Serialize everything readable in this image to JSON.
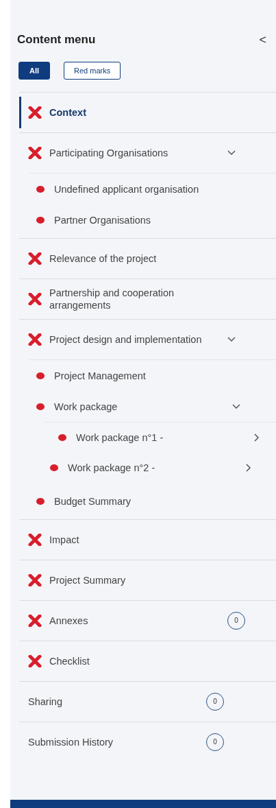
{
  "header": {
    "title": "Content menu",
    "collapse_icon": "<"
  },
  "filters": [
    {
      "label": "All",
      "selected": true
    },
    {
      "label": "Red marks",
      "selected": false
    }
  ],
  "items": [
    {
      "label": "Context",
      "marked": true,
      "selected": true
    },
    {
      "label": "Participating Organisations",
      "marked": true,
      "selected": false,
      "expanded": true,
      "children": [
        {
          "label": "Undefined applicant organisation",
          "marked": true,
          "selected": false
        },
        {
          "label": "Partner Organisations",
          "marked": true,
          "selected": false
        }
      ]
    },
    {
      "label": "Relevance of the project",
      "marked": true,
      "selected": false
    },
    {
      "label": "Partnership and cooperation arrangements",
      "marked": true,
      "selected": false
    },
    {
      "label": "Project design and implementation",
      "marked": true,
      "selected": false,
      "expanded": true,
      "children": [
        {
          "label": "Project Management",
          "marked": true,
          "selected": false
        },
        {
          "label": "Work package",
          "marked": true,
          "selected": false,
          "expanded": true,
          "children": [
            {
              "label": "Work package n°1 -",
              "marked": true,
              "selected": false,
              "expanded": false
            },
            {
              "label": "Work package n°2 -",
              "marked": true,
              "selected": false,
              "expanded": false
            }
          ]
        },
        {
          "label": "Budget Summary",
          "marked": true,
          "selected": false
        }
      ]
    },
    {
      "label": "Impact",
      "marked": true,
      "selected": false
    },
    {
      "label": "Project Summary",
      "marked": true,
      "selected": false
    },
    {
      "label": "Annexes",
      "marked": true,
      "selected": false,
      "count": "0"
    },
    {
      "label": "Checklist",
      "marked": true,
      "selected": false
    },
    {
      "label": "Sharing",
      "marked": false,
      "selected": false,
      "count": "0"
    },
    {
      "label": "Submission History",
      "marked": false,
      "selected": false,
      "count": "0"
    }
  ]
}
